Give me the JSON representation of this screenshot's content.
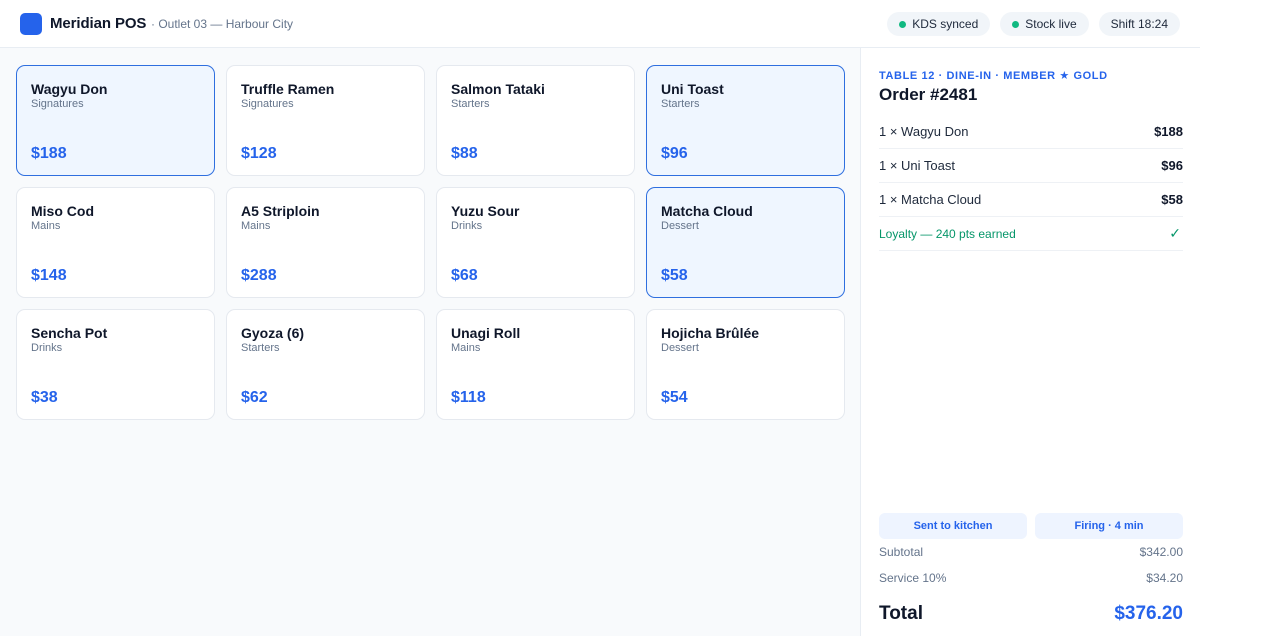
{
  "header": {
    "brand": "Meridian POS",
    "outlet": "· Outlet 03 — Harbour City",
    "pills": [
      {
        "label": "KDS synced",
        "dot": true
      },
      {
        "label": "Stock live",
        "dot": true
      },
      {
        "label": "Shift 18:24",
        "dot": false
      }
    ]
  },
  "colors": {
    "accent": "#2563eb",
    "success": "#10b981",
    "selected_bg": "#eff6ff"
  },
  "menu": [
    {
      "name": "Wagyu Don",
      "category": "Signatures",
      "price": "$188",
      "selected": true
    },
    {
      "name": "Truffle Ramen",
      "category": "Signatures",
      "price": "$128",
      "selected": false
    },
    {
      "name": "Salmon Tataki",
      "category": "Starters",
      "price": "$88",
      "selected": false
    },
    {
      "name": "Uni Toast",
      "category": "Starters",
      "price": "$96",
      "selected": true
    },
    {
      "name": "Miso Cod",
      "category": "Mains",
      "price": "$148",
      "selected": false
    },
    {
      "name": "A5 Striploin",
      "category": "Mains",
      "price": "$288",
      "selected": false
    },
    {
      "name": "Yuzu Sour",
      "category": "Drinks",
      "price": "$68",
      "selected": false
    },
    {
      "name": "Matcha Cloud",
      "category": "Dessert",
      "price": "$58",
      "selected": true
    },
    {
      "name": "Sencha Pot",
      "category": "Drinks",
      "price": "$38",
      "selected": false
    },
    {
      "name": "Gyoza (6)",
      "category": "Starters",
      "price": "$62",
      "selected": false
    },
    {
      "name": "Unagi Roll",
      "category": "Mains",
      "price": "$118",
      "selected": false
    },
    {
      "name": "Hojicha Brûlée",
      "category": "Dessert",
      "price": "$54",
      "selected": false
    }
  ],
  "order": {
    "table_meta": "TABLE 12 · DINE-IN · MEMBER ★ GOLD",
    "order_number": "Order #2481",
    "lines": [
      {
        "label": "1 × Wagyu Don",
        "amount": "$188"
      },
      {
        "label": "1 × Uni Toast",
        "amount": "$96"
      },
      {
        "label": "1 × Matcha Cloud",
        "amount": "$58"
      }
    ],
    "loyalty": "Loyalty — 240 pts earned",
    "loyalty_icon": "check-icon",
    "status": [
      "Sent to kitchen",
      "Firing · 4 min"
    ],
    "subtotal_label": "Subtotal",
    "subtotal_value": "$342.00",
    "service_label": "Service 10%",
    "service_value": "$34.20",
    "total_label": "Total",
    "total_value": "$376.20"
  }
}
